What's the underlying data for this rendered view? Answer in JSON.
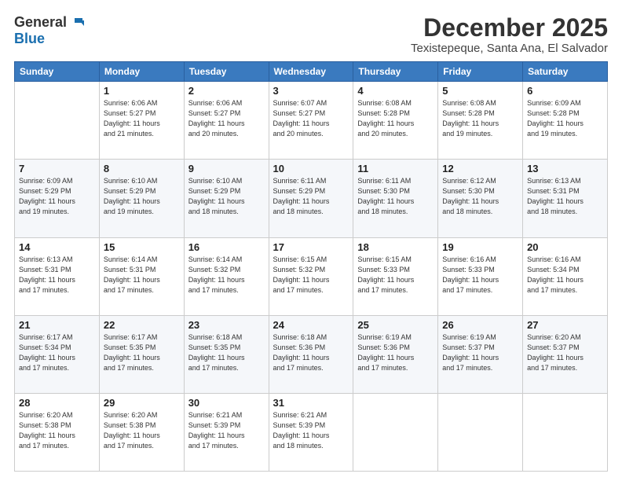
{
  "logo": {
    "general": "General",
    "blue": "Blue"
  },
  "header": {
    "title": "December 2025",
    "subtitle": "Texistepeque, Santa Ana, El Salvador"
  },
  "days_of_week": [
    "Sunday",
    "Monday",
    "Tuesday",
    "Wednesday",
    "Thursday",
    "Friday",
    "Saturday"
  ],
  "weeks": [
    [
      {
        "day": "",
        "info": ""
      },
      {
        "day": "1",
        "info": "Sunrise: 6:06 AM\nSunset: 5:27 PM\nDaylight: 11 hours\nand 21 minutes."
      },
      {
        "day": "2",
        "info": "Sunrise: 6:06 AM\nSunset: 5:27 PM\nDaylight: 11 hours\nand 20 minutes."
      },
      {
        "day": "3",
        "info": "Sunrise: 6:07 AM\nSunset: 5:27 PM\nDaylight: 11 hours\nand 20 minutes."
      },
      {
        "day": "4",
        "info": "Sunrise: 6:08 AM\nSunset: 5:28 PM\nDaylight: 11 hours\nand 20 minutes."
      },
      {
        "day": "5",
        "info": "Sunrise: 6:08 AM\nSunset: 5:28 PM\nDaylight: 11 hours\nand 19 minutes."
      },
      {
        "day": "6",
        "info": "Sunrise: 6:09 AM\nSunset: 5:28 PM\nDaylight: 11 hours\nand 19 minutes."
      }
    ],
    [
      {
        "day": "7",
        "info": "Sunrise: 6:09 AM\nSunset: 5:29 PM\nDaylight: 11 hours\nand 19 minutes."
      },
      {
        "day": "8",
        "info": "Sunrise: 6:10 AM\nSunset: 5:29 PM\nDaylight: 11 hours\nand 19 minutes."
      },
      {
        "day": "9",
        "info": "Sunrise: 6:10 AM\nSunset: 5:29 PM\nDaylight: 11 hours\nand 18 minutes."
      },
      {
        "day": "10",
        "info": "Sunrise: 6:11 AM\nSunset: 5:29 PM\nDaylight: 11 hours\nand 18 minutes."
      },
      {
        "day": "11",
        "info": "Sunrise: 6:11 AM\nSunset: 5:30 PM\nDaylight: 11 hours\nand 18 minutes."
      },
      {
        "day": "12",
        "info": "Sunrise: 6:12 AM\nSunset: 5:30 PM\nDaylight: 11 hours\nand 18 minutes."
      },
      {
        "day": "13",
        "info": "Sunrise: 6:13 AM\nSunset: 5:31 PM\nDaylight: 11 hours\nand 18 minutes."
      }
    ],
    [
      {
        "day": "14",
        "info": "Sunrise: 6:13 AM\nSunset: 5:31 PM\nDaylight: 11 hours\nand 17 minutes."
      },
      {
        "day": "15",
        "info": "Sunrise: 6:14 AM\nSunset: 5:31 PM\nDaylight: 11 hours\nand 17 minutes."
      },
      {
        "day": "16",
        "info": "Sunrise: 6:14 AM\nSunset: 5:32 PM\nDaylight: 11 hours\nand 17 minutes."
      },
      {
        "day": "17",
        "info": "Sunrise: 6:15 AM\nSunset: 5:32 PM\nDaylight: 11 hours\nand 17 minutes."
      },
      {
        "day": "18",
        "info": "Sunrise: 6:15 AM\nSunset: 5:33 PM\nDaylight: 11 hours\nand 17 minutes."
      },
      {
        "day": "19",
        "info": "Sunrise: 6:16 AM\nSunset: 5:33 PM\nDaylight: 11 hours\nand 17 minutes."
      },
      {
        "day": "20",
        "info": "Sunrise: 6:16 AM\nSunset: 5:34 PM\nDaylight: 11 hours\nand 17 minutes."
      }
    ],
    [
      {
        "day": "21",
        "info": "Sunrise: 6:17 AM\nSunset: 5:34 PM\nDaylight: 11 hours\nand 17 minutes."
      },
      {
        "day": "22",
        "info": "Sunrise: 6:17 AM\nSunset: 5:35 PM\nDaylight: 11 hours\nand 17 minutes."
      },
      {
        "day": "23",
        "info": "Sunrise: 6:18 AM\nSunset: 5:35 PM\nDaylight: 11 hours\nand 17 minutes."
      },
      {
        "day": "24",
        "info": "Sunrise: 6:18 AM\nSunset: 5:36 PM\nDaylight: 11 hours\nand 17 minutes."
      },
      {
        "day": "25",
        "info": "Sunrise: 6:19 AM\nSunset: 5:36 PM\nDaylight: 11 hours\nand 17 minutes."
      },
      {
        "day": "26",
        "info": "Sunrise: 6:19 AM\nSunset: 5:37 PM\nDaylight: 11 hours\nand 17 minutes."
      },
      {
        "day": "27",
        "info": "Sunrise: 6:20 AM\nSunset: 5:37 PM\nDaylight: 11 hours\nand 17 minutes."
      }
    ],
    [
      {
        "day": "28",
        "info": "Sunrise: 6:20 AM\nSunset: 5:38 PM\nDaylight: 11 hours\nand 17 minutes."
      },
      {
        "day": "29",
        "info": "Sunrise: 6:20 AM\nSunset: 5:38 PM\nDaylight: 11 hours\nand 17 minutes."
      },
      {
        "day": "30",
        "info": "Sunrise: 6:21 AM\nSunset: 5:39 PM\nDaylight: 11 hours\nand 17 minutes."
      },
      {
        "day": "31",
        "info": "Sunrise: 6:21 AM\nSunset: 5:39 PM\nDaylight: 11 hours\nand 18 minutes."
      },
      {
        "day": "",
        "info": ""
      },
      {
        "day": "",
        "info": ""
      },
      {
        "day": "",
        "info": ""
      }
    ]
  ]
}
